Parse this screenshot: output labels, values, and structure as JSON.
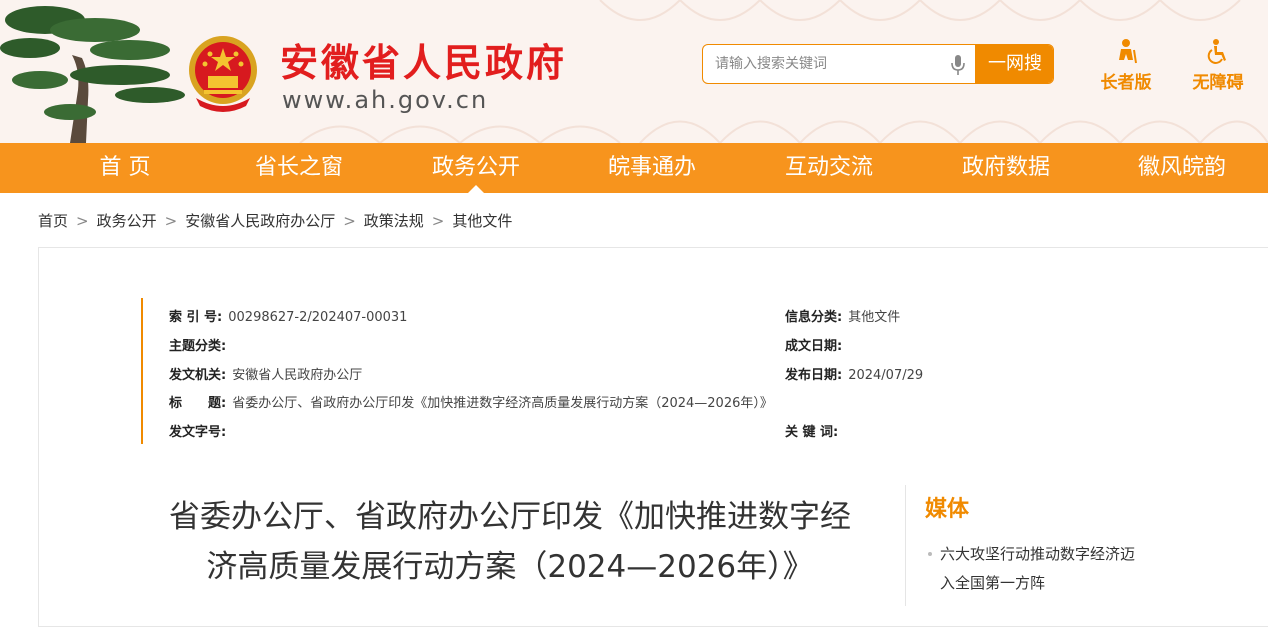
{
  "header": {
    "site_name": "安徽省人民政府",
    "site_url": "www.ah.gov.cn",
    "search_placeholder": "请输入搜索关键词",
    "search_button": "一网搜",
    "elder_label": "长者版",
    "accessible_label": "无障碍",
    "accent_color": "#f08a00",
    "brand_red": "#e21e1e"
  },
  "nav": {
    "items": [
      "首 页",
      "省长之窗",
      "政务公开",
      "皖事通办",
      "互动交流",
      "政府数据",
      "徽风皖韵"
    ],
    "active": "政务公开"
  },
  "breadcrumb": [
    "首页",
    "政务公开",
    "安徽省人民政府办公厅",
    "政策法规",
    "其他文件"
  ],
  "meta": {
    "index_key": "索 引 号:",
    "index_val": "00298627-2/202407-00031",
    "category_key": "信息分类:",
    "category_val": "其他文件",
    "topic_key": "主题分类:",
    "topic_val": "",
    "created_key": "成文日期:",
    "created_val": "",
    "issuer_key": "发文机关:",
    "issuer_val": "安徽省人民政府办公厅",
    "published_key": "发布日期:",
    "published_val": "2024/07/29",
    "title_key": "标　　题:",
    "title_val": "省委办公厅、省政府办公厅印发《加快推进数字经济高质量发展行动方案（2024—2026年）》",
    "docno_key": "发文字号:",
    "docno_val": "",
    "keywords_key": "关 键 词:",
    "keywords_val": ""
  },
  "article": {
    "title_line1": "省委办公厅、省政府办公厅印发《加快推进数字经",
    "title_line2": "济高质量发展行动方案（2024—2026年）》"
  },
  "sidebar": {
    "heading": "媒体",
    "items": [
      {
        "line1": "六大攻坚行动推动数字经济迈",
        "line2": "入全国第一方阵"
      }
    ]
  }
}
